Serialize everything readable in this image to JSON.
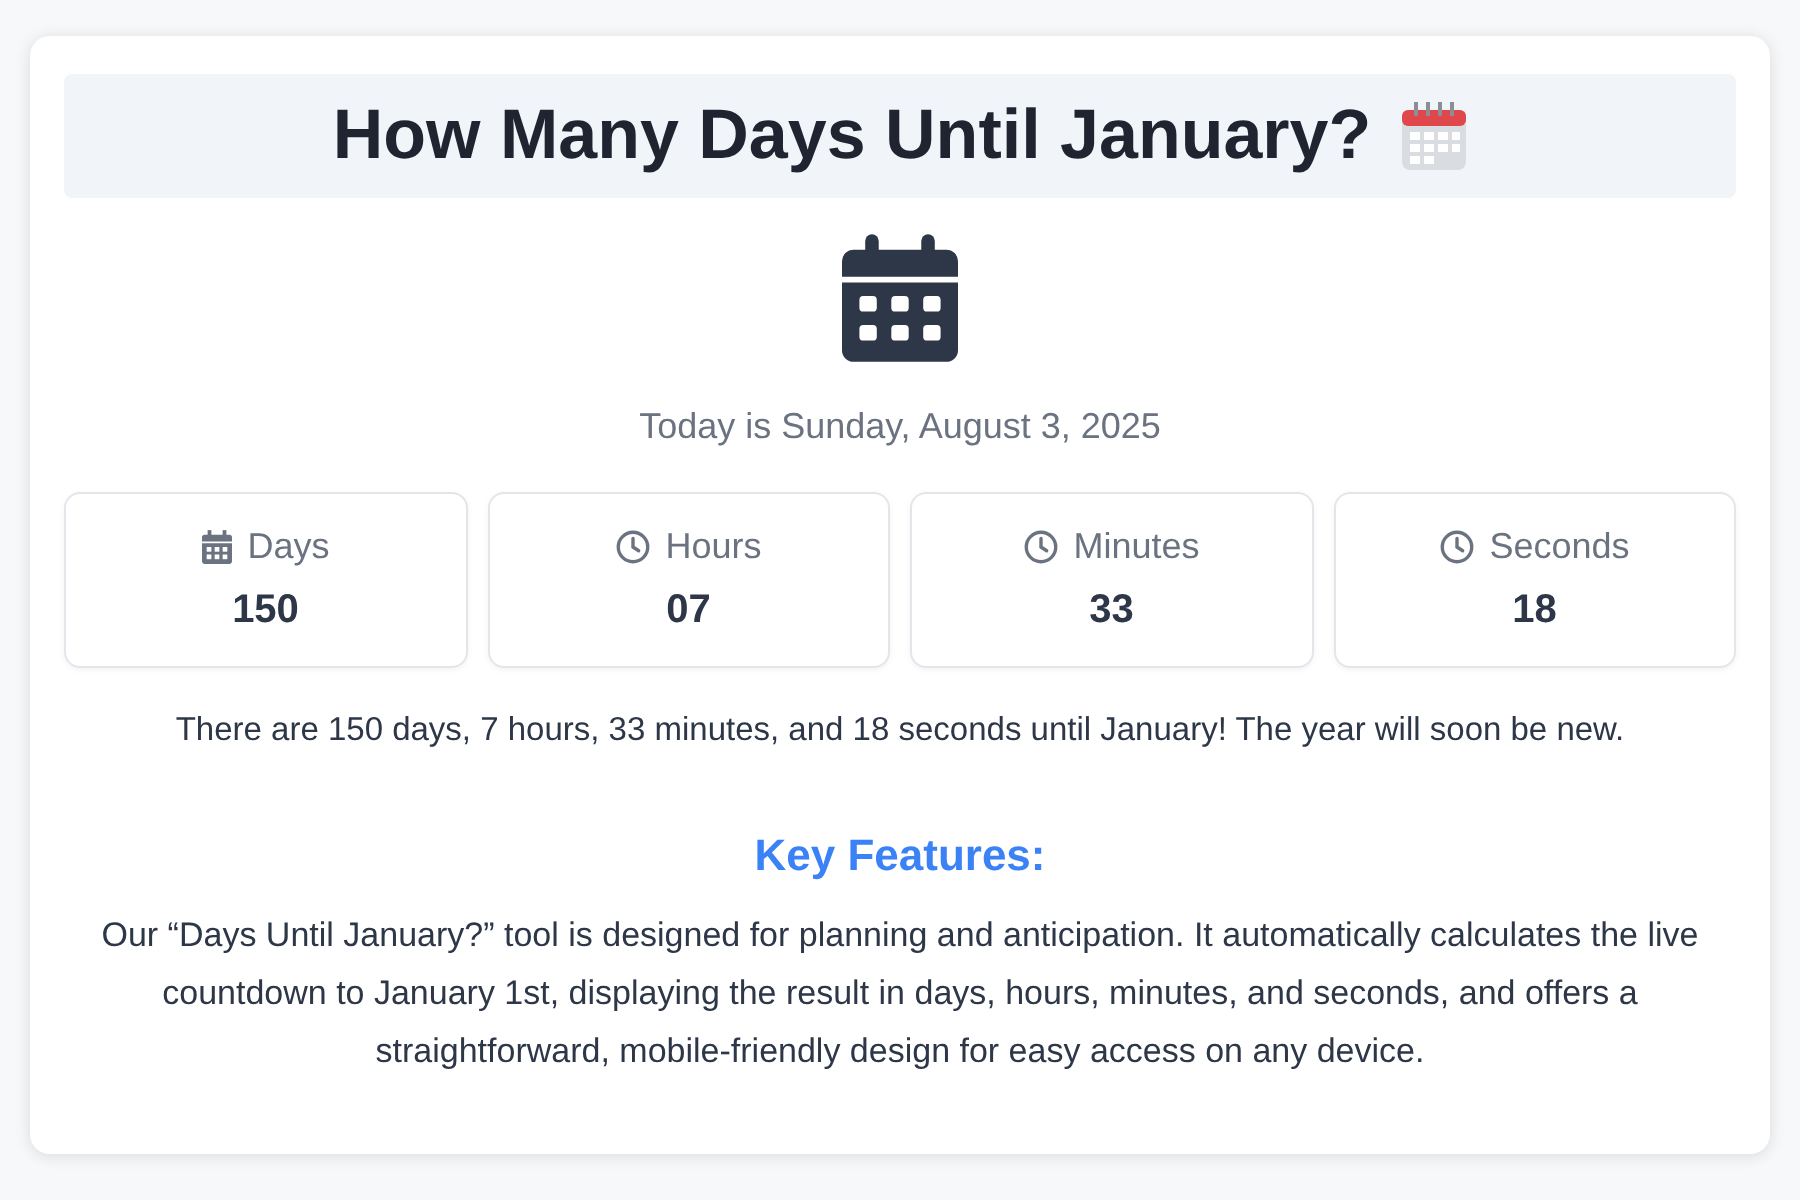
{
  "title": "How Many Days Until January?",
  "today": "Today is Sunday, August 3, 2025",
  "units": [
    {
      "kind": "calendar",
      "label": "Days",
      "value": "150"
    },
    {
      "kind": "clock",
      "label": "Hours",
      "value": "07"
    },
    {
      "kind": "clock",
      "label": "Minutes",
      "value": "33"
    },
    {
      "kind": "clock",
      "label": "Seconds",
      "value": "18"
    }
  ],
  "summary": "There are 150 days, 7 hours, 33 minutes, and 18 seconds until January! The year will soon be new.",
  "features_heading": "Key Features:",
  "features_text": "Our “Days Until January?” tool is designed for planning and anticipation. It automatically calculates the live countdown to January 1st, displaying the result in days, hours, minutes, and seconds, and offers a straightforward, mobile-friendly design for easy access on any device."
}
